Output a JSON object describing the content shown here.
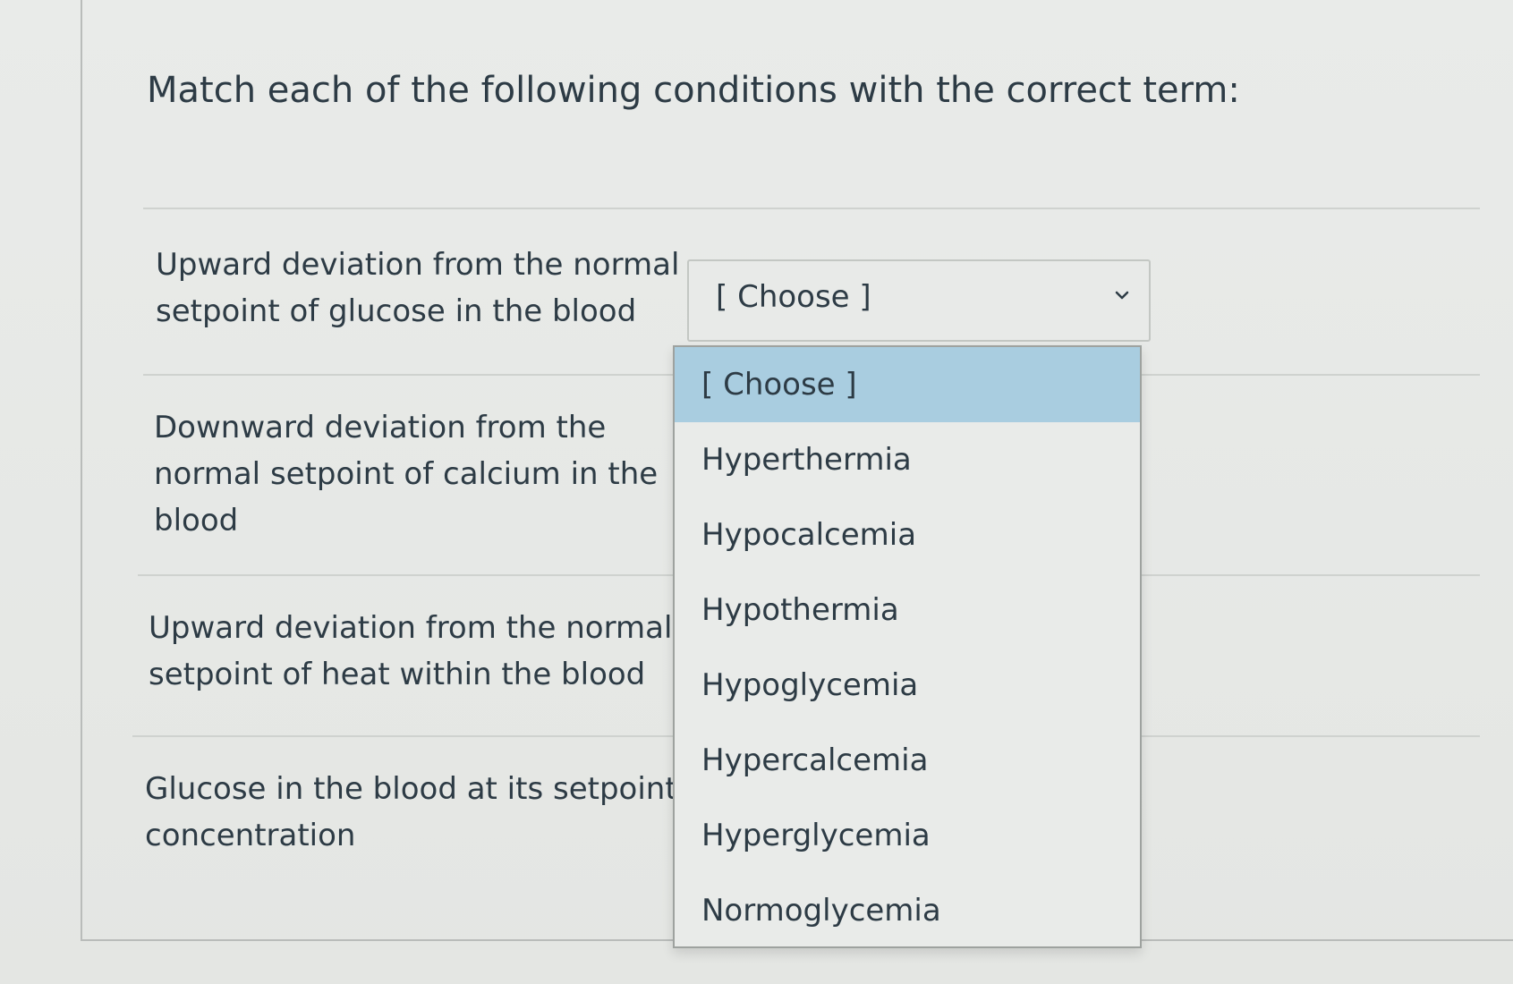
{
  "question": {
    "prompt": "Match each of the following conditions with the correct term:"
  },
  "rows": [
    {
      "line1": "Upward deviation from the normal",
      "line2": "setpoint of glucose in the blood",
      "line3": ""
    },
    {
      "line1": "Downward deviation from the",
      "line2": "normal setpoint of calcium in the",
      "line3": "blood"
    },
    {
      "line1": "Upward deviation from the normal",
      "line2": "setpoint of heat within the blood",
      "line3": ""
    },
    {
      "line1": "Glucose in the blood at its setpoint",
      "line2": "concentration",
      "line3": ""
    }
  ],
  "select": {
    "value": "[ Choose ]",
    "icon": "chevron-down-icon"
  },
  "dropdown": {
    "options": [
      "[ Choose ]",
      "Hyperthermia",
      "Hypocalcemia",
      "Hypothermia",
      "Hypoglycemia",
      "Hypercalcemia",
      "Hyperglycemia",
      "Normoglycemia"
    ],
    "highlighted_option": "[ Choose ]",
    "highlight_color": "#a9cde0"
  }
}
